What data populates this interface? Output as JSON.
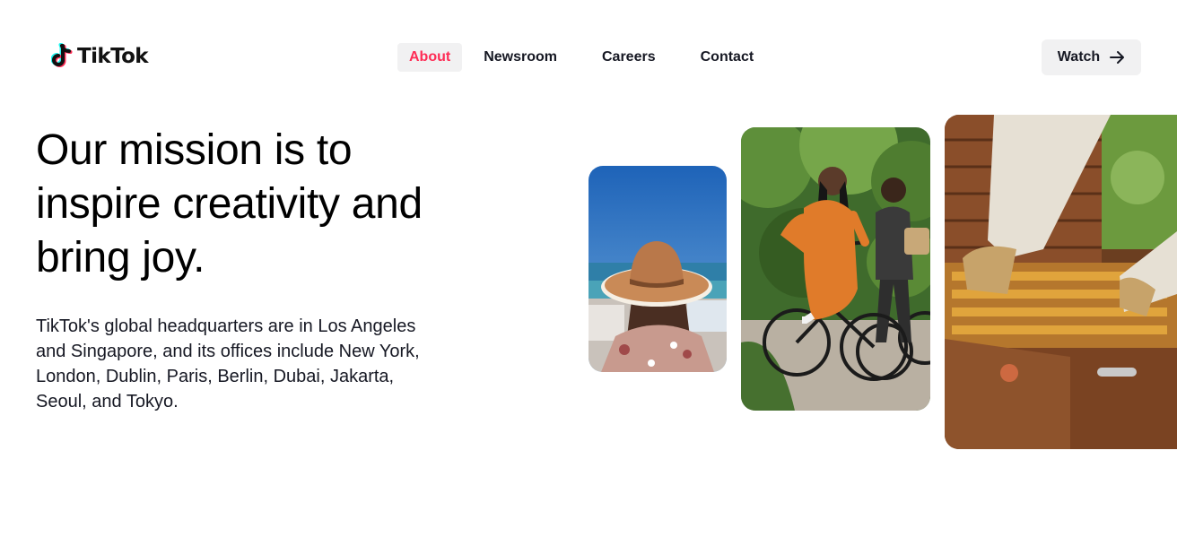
{
  "brand": {
    "name": "TikTok",
    "logo_icon": "tiktok-note-icon"
  },
  "nav": {
    "items": [
      {
        "label": "About",
        "active": true
      },
      {
        "label": "Newsroom",
        "active": false
      },
      {
        "label": "Careers",
        "active": false
      },
      {
        "label": "Contact",
        "active": false
      }
    ],
    "cta": {
      "label": "Watch",
      "icon": "arrow-right-icon"
    }
  },
  "hero": {
    "headline": "Our mission is to inspire creativity and bring joy.",
    "body": "TikTok's global headquarters are in Los Angeles and Singapore, and its offices include New York, London, Dublin, Paris, Berlin, Dubai, Jakarta, Seoul, and Tokyo."
  },
  "colors": {
    "accent": "#fe2c55",
    "cyan": "#25f4ee",
    "chip_bg": "#f1f1f2",
    "text": "#161823"
  }
}
